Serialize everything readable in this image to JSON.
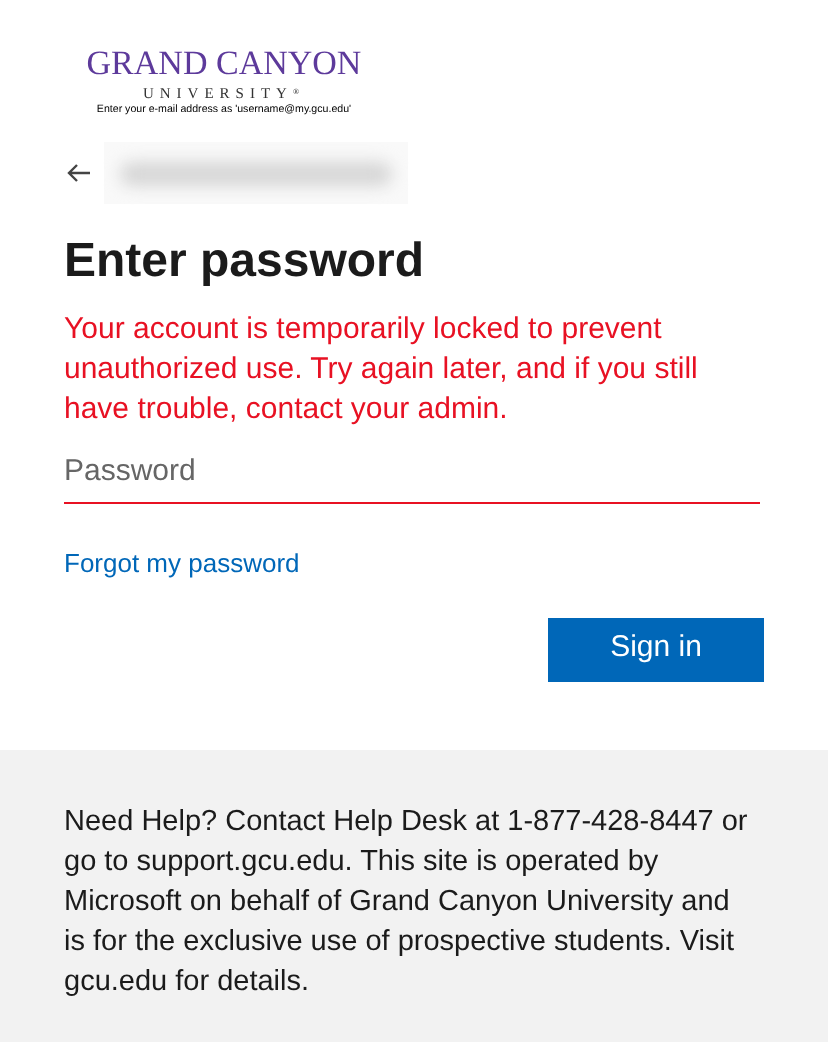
{
  "logo": {
    "name": "GRAND CANYON",
    "subtitle": "UNIVERSITY",
    "mark": "®",
    "hint": "Enter your e-mail address as 'username@my.gcu.edu'"
  },
  "identity": {
    "blurred": true
  },
  "heading": "Enter password",
  "error": "Your account is temporarily locked to prevent unauthorized use. Try again later, and if you still have trouble, contact your admin.",
  "password_field": {
    "placeholder": "Password",
    "invalid": true
  },
  "forgot_link": "Forgot my password",
  "sign_in_button": "Sign in",
  "footer": "Need Help? Contact Help Desk at 1-877-428-8447 or go to support.gcu.edu. This site is operated by Microsoft on behalf of Grand Canyon University and is for the exclusive use of prospective students. Visit gcu.edu for details."
}
